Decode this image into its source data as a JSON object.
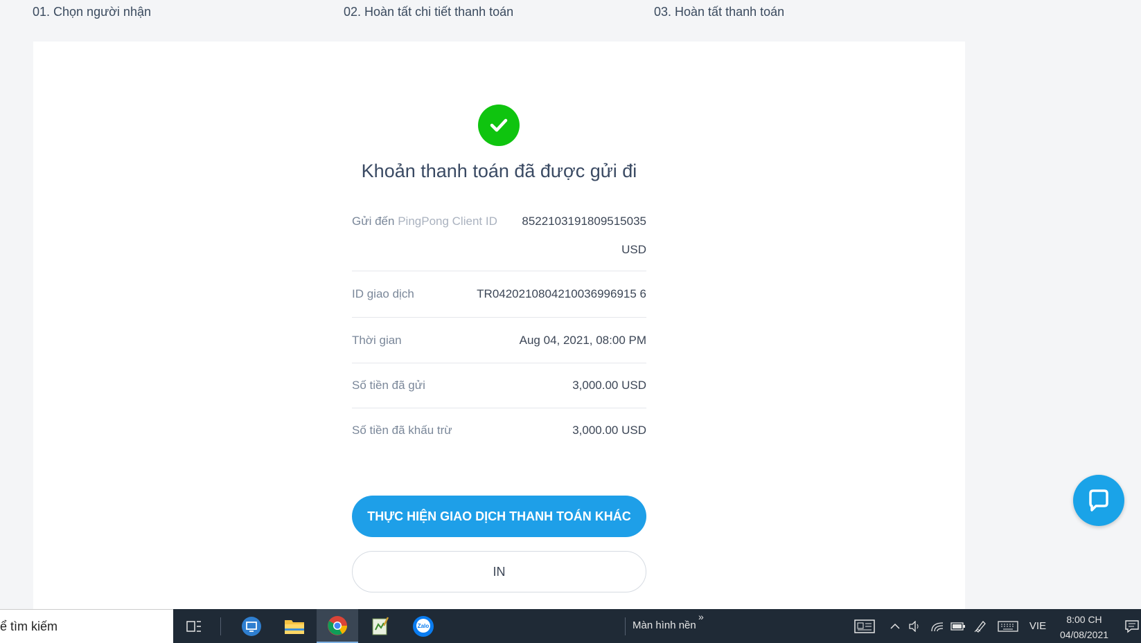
{
  "steps": [
    {
      "label": "01. Chọn người nhận"
    },
    {
      "label": "02. Hoàn tất chi tiết thanh toán"
    },
    {
      "label": "03. Hoàn tất thanh toán"
    }
  ],
  "title": "Khoản thanh toán đã được gửi đi",
  "details": {
    "send_to_label": "Gửi đến",
    "send_to_sublabel": "PingPong Client ID",
    "send_to_value": "8522103191809515035",
    "send_to_currency": "USD",
    "transaction_id_label": "ID giao dịch",
    "transaction_id_value": "TR0420210804210036996915 6",
    "time_label": "Thời gian",
    "time_value": "Aug 04, 2021, 08:00 PM",
    "amount_sent_label": "Số tiền đã gửi",
    "amount_sent_value": "3,000.00 USD",
    "amount_deducted_label": "Số tiền đã khấu trừ",
    "amount_deducted_value": "3,000.00 USD"
  },
  "buttons": {
    "new_payment": "THỰC HIỆN GIAO DỊCH THANH TOÁN KHÁC",
    "print": "IN"
  },
  "colors": {
    "success": "#0fc40f",
    "primary": "#1e9fe8"
  },
  "taskbar": {
    "search_text": "ể tìm kiếm",
    "desktop_label": "Màn hình nền",
    "language": "VIE",
    "time": "8:00 CH",
    "date": "04/08/2021"
  }
}
